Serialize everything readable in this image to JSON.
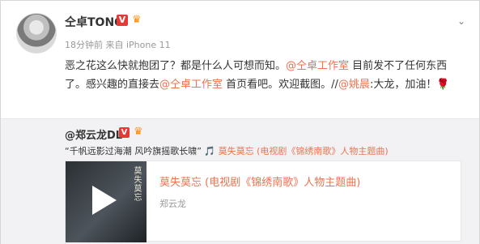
{
  "post": {
    "username": "仝卓TONG",
    "vip_mark": "V",
    "meta": "18分钟前 来自 iPhone 11",
    "text_segments": [
      {
        "text": "恶之花这么快就抱团了？都是什么人可想而知。",
        "style": "normal"
      },
      {
        "text": "@仝卓工作室",
        "style": "link"
      },
      {
        "text": " 目前发不了任何东西了。感兴趣的直接去",
        "style": "normal"
      },
      {
        "text": "@仝卓工作室",
        "style": "link"
      },
      {
        "text": " 首页看吧。欢迎截图。//",
        "style": "normal"
      },
      {
        "text": "@姚晨",
        "style": "link"
      },
      {
        "text": ":大龙，加油！",
        "style": "normal"
      },
      {
        "text": "🌹",
        "style": "rose"
      }
    ],
    "menu_icon": "chevron-down-icon"
  },
  "repost": {
    "username": "@郑云龙DL",
    "vip_mark": "V",
    "line_text": "“千帆远影过海潮  风吟旗摇歌长啸” ",
    "music_link": "莫失莫忘 (电视剧《锦绣南歌》人物主题曲)",
    "card": {
      "title": "莫失莫忘 (电视剧《锦绣南歌》人物主题曲)",
      "artist": "郑云龙",
      "cover_text": "莫失莫忘"
    }
  },
  "colors": {
    "link": "#eb7350",
    "vip": "#e53935",
    "crown": "#ff8a00",
    "repost_bg": "#f2f2f5"
  }
}
